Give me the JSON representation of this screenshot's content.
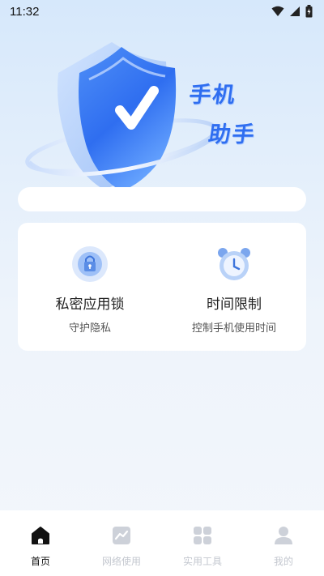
{
  "status_bar": {
    "time": "11:32",
    "icons": [
      "wifi-icon",
      "signal-icon",
      "battery-icon"
    ]
  },
  "hero": {
    "title_line1": "手机",
    "title_line2": "助手",
    "accent_color": "#2f6ef0"
  },
  "search": {
    "placeholder": ""
  },
  "features": [
    {
      "title": "私密应用锁",
      "subtitle": "守护隐私",
      "icon": "lock-icon"
    },
    {
      "title": "时间限制",
      "subtitle": "控制手机使用时间",
      "icon": "alarm-clock-icon"
    }
  ],
  "bottom_nav": {
    "items": [
      {
        "label": "首页",
        "icon": "home-icon",
        "active": true
      },
      {
        "label": "网络使用",
        "icon": "network-chart-icon",
        "active": false
      },
      {
        "label": "实用工具",
        "icon": "tools-grid-icon",
        "active": false
      },
      {
        "label": "我的",
        "icon": "profile-icon",
        "active": false
      }
    ]
  },
  "colors": {
    "active_nav": "#111111",
    "inactive_nav": "#c3c7cf",
    "background_top": "#d6e8fb"
  }
}
